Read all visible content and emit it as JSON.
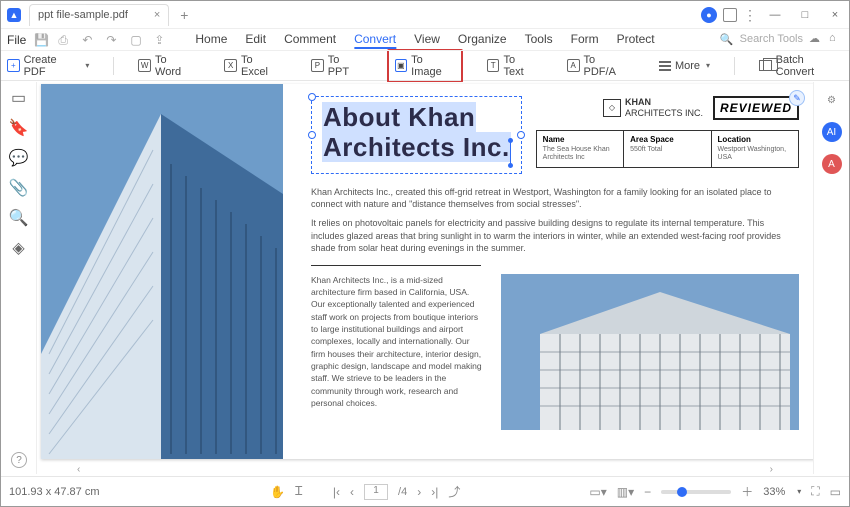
{
  "titlebar": {
    "tab_title": "ppt file-sample.pdf"
  },
  "file_menu": "File",
  "main_menu": [
    "Home",
    "Edit",
    "Comment",
    "Convert",
    "View",
    "Organize",
    "Tools",
    "Form",
    "Protect"
  ],
  "active_menu_index": 3,
  "search_placeholder": "Search Tools",
  "toolbar": {
    "create": "Create PDF",
    "to_word": "To Word",
    "to_excel": "To Excel",
    "to_ppt": "To PPT",
    "to_image": "To Image",
    "to_text": "To Text",
    "to_pdfa": "To PDF/A",
    "more": "More",
    "batch": "Batch Convert"
  },
  "doc": {
    "title_l1": "About Khan",
    "title_l2": "Architects Inc.",
    "brand_name": "KHAN",
    "brand_sub": "ARCHITECTS INC.",
    "reviewed": "REVIEWED",
    "info": {
      "h1": "Name",
      "v1": "The Sea House Khan Architects Inc",
      "h2": "Area Space",
      "v2": "550ft Total",
      "h3": "Location",
      "v3": "Westport Washington, USA"
    },
    "p1": "Khan Architects Inc., created this off-grid retreat in Westport, Washington for a family looking for an isolated place to connect with nature and \"distance themselves from social stresses\".",
    "p2": "It relies on photovoltaic panels for electricity and passive building designs to regulate its internal temperature. This includes glazed areas that bring sunlight in to warm the interiors in winter, while an extended west-facing roof provides shade from solar heat during evenings in the summer.",
    "p3": "Khan Architects Inc., is a mid-sized architecture firm based in California, USA. Our exceptionally talented and experienced staff work on projects from boutique interiors to large institutional buildings and airport complexes, locally and internationally. Our firm houses their architecture, interior design, graphic design, landscape and model making staff. We strieve to be leaders in the community through work, research and personal choices."
  },
  "status": {
    "coords": "101.93 x 47.87 cm",
    "page_current": "1",
    "page_total": "/4",
    "zoom": "33%"
  }
}
